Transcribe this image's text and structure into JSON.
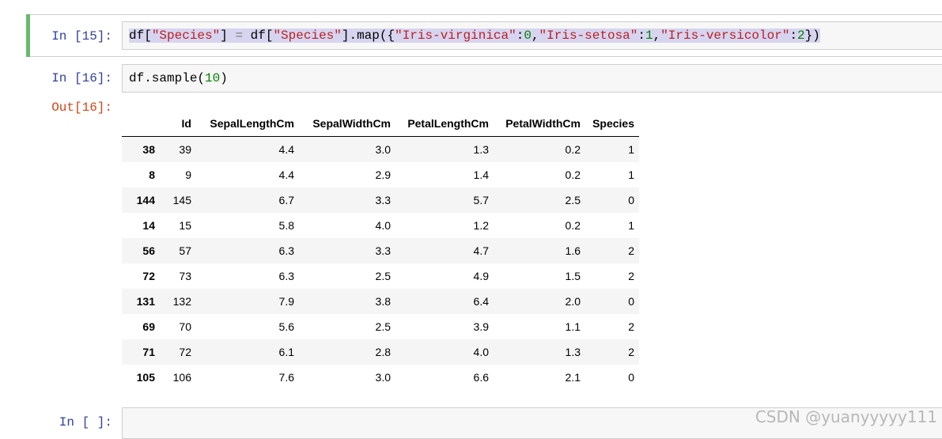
{
  "cells": [
    {
      "prompt": "In  [15]:",
      "code_tokens": [
        {
          "t": "df[",
          "c": ""
        },
        {
          "t": "\"Species\"",
          "c": "str"
        },
        {
          "t": "] ",
          "c": ""
        },
        {
          "t": "=",
          "c": "op"
        },
        {
          "t": " df[",
          "c": ""
        },
        {
          "t": "\"Species\"",
          "c": "str"
        },
        {
          "t": "].map({",
          "c": ""
        },
        {
          "t": "\"Iris-virginica\"",
          "c": "str"
        },
        {
          "t": ":",
          "c": ""
        },
        {
          "t": "0",
          "c": "num"
        },
        {
          "t": ",",
          "c": ""
        },
        {
          "t": "\"Iris-setosa\"",
          "c": "str"
        },
        {
          "t": ":",
          "c": ""
        },
        {
          "t": "1",
          "c": "num"
        },
        {
          "t": ",",
          "c": ""
        },
        {
          "t": "\"Iris-versicolor\"",
          "c": "str"
        },
        {
          "t": ":",
          "c": ""
        },
        {
          "t": "2",
          "c": "num"
        },
        {
          "t": "})",
          "c": ""
        }
      ]
    },
    {
      "prompt": "In  [16]:",
      "code_tokens": [
        {
          "t": "df.sample(",
          "c": ""
        },
        {
          "t": "10",
          "c": "num"
        },
        {
          "t": ")",
          "c": ""
        }
      ]
    },
    {
      "prompt": "In  [  ]:"
    }
  ],
  "output": {
    "prompt": "Out[16]:",
    "columns": [
      "",
      "Id",
      "SepalLengthCm",
      "SepalWidthCm",
      "PetalLengthCm",
      "PetalWidthCm",
      "Species"
    ],
    "rows": [
      [
        "38",
        "39",
        "4.4",
        "3.0",
        "1.3",
        "0.2",
        "1"
      ],
      [
        "8",
        "9",
        "4.4",
        "2.9",
        "1.4",
        "0.2",
        "1"
      ],
      [
        "144",
        "145",
        "6.7",
        "3.3",
        "5.7",
        "2.5",
        "0"
      ],
      [
        "14",
        "15",
        "5.8",
        "4.0",
        "1.2",
        "0.2",
        "1"
      ],
      [
        "56",
        "57",
        "6.3",
        "3.3",
        "4.7",
        "1.6",
        "2"
      ],
      [
        "72",
        "73",
        "6.3",
        "2.5",
        "4.9",
        "1.5",
        "2"
      ],
      [
        "131",
        "132",
        "7.9",
        "3.8",
        "6.4",
        "2.0",
        "0"
      ],
      [
        "69",
        "70",
        "5.6",
        "2.5",
        "3.9",
        "1.1",
        "2"
      ],
      [
        "71",
        "72",
        "6.1",
        "2.8",
        "4.0",
        "1.3",
        "2"
      ],
      [
        "105",
        "106",
        "7.6",
        "3.0",
        "6.6",
        "2.1",
        "0"
      ]
    ]
  },
  "watermark": "CSDN @yuanyyyyy111",
  "colors": {
    "selected_bar": "#66bb6a",
    "in_prompt": "#303f9f",
    "out_prompt": "#d84315",
    "string": "#ba2121",
    "number": "#008000"
  }
}
